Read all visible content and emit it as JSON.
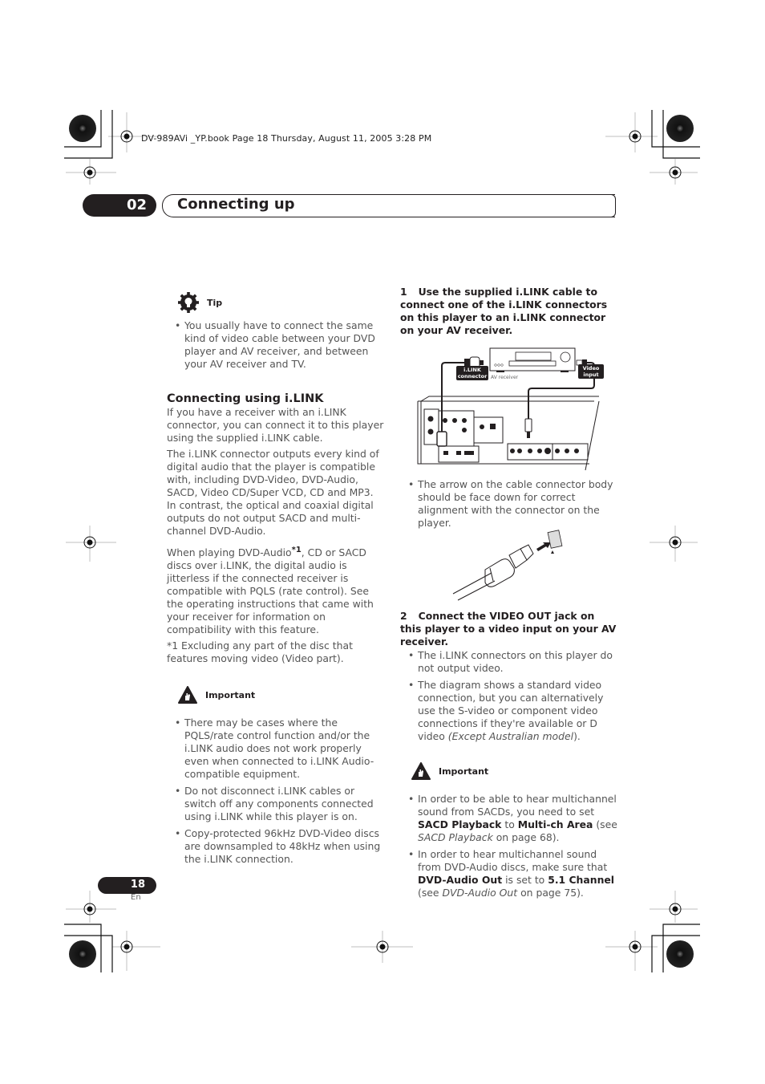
{
  "print_header": "DV-989AVi _YP.book  Page 18  Thursday, August 11, 2005  3:28 PM",
  "chapter": {
    "number": "02",
    "title": "Connecting up"
  },
  "left_column": {
    "tip": {
      "icon": "lightbulb-gear-icon",
      "label": "Tip",
      "bullets": [
        "You usually have to connect the same kind of video cable between your DVD player and AV receiver, and between your AV receiver and TV."
      ]
    },
    "section_heading": "Connecting using i.LINK",
    "paragraphs": [
      "If you have a receiver with an i.LINK connector, you can connect it to this player using the supplied i.LINK cable.",
      "The i.LINK connector outputs every kind of digital audio that the player is compatible with, including DVD-Video, DVD-Audio, SACD, Video CD/Super VCD, CD and MP3. In contrast, the optical and coaxial digital outputs do not output SACD and multi-channel DVD-Audio."
    ],
    "para3_before": "When playing DVD-Audio",
    "para3_footnote_ref": "*1",
    "para3_after": ", CD or SACD discs over i.LINK, the digital audio is jitterless if the connected receiver is compatible with PQLS (rate control). See the operating instructions that came with your receiver for information on compatibility with this feature.",
    "footnote": "*1 Excluding any part of the disc that features moving video (Video part).",
    "important": {
      "icon": "warning-hand-icon",
      "label": "Important",
      "bullets": [
        "There may be cases where the PQLS/rate control function and/or the i.LINK audio does not work properly even when connected to i.LINK Audio-compatible equipment.",
        "Do not disconnect i.LINK cables or switch off any components connected using i.LINK while this player is on.",
        "Copy-protected 96kHz DVD-Video discs are downsampled to 48kHz when using the i.LINK connection."
      ]
    }
  },
  "right_column": {
    "step1": {
      "number": "1",
      "text": "Use the supplied i.LINK cable to connect one of the i.LINK connectors on this player to an i.LINK connector on your AV receiver."
    },
    "diagram": {
      "label_ilink_line1": "i.LINK",
      "label_ilink_line2": "connector",
      "label_receiver": "AV receiver",
      "label_video_line1": "Video",
      "label_video_line2": "input"
    },
    "step1_bullet": "The arrow on the cable connector body should be face down for correct alignment with the connector on the player.",
    "step2": {
      "number": "2",
      "text": "Connect the VIDEO OUT jack on this player to a video input on your AV receiver."
    },
    "step2_bullets": {
      "b1": "The i.LINK connectors on this player do not output video.",
      "b2_text": "The diagram shows a standard video connection, but you can alternatively use the S-video or component video connections if they're available or D video ",
      "b2_italic": "(Except Australian model",
      "b2_end": ")."
    },
    "important": {
      "label": "Important",
      "b1": {
        "t1": "In order to be able to hear multichannel sound from SACDs, you need to set ",
        "k1": "SACD Playback",
        "t2": " to ",
        "k2": "Multi-ch Area",
        "t3": " (see ",
        "i1": "SACD Playback",
        "t4": " on page 68)."
      },
      "b2": {
        "t1": "In order to hear multichannel sound from DVD-Audio discs, make sure that ",
        "k1": "DVD-Audio Out",
        "t2": " is set to ",
        "k2": "5.1 Channel",
        "t3": " (see ",
        "i1": "DVD-Audio Out",
        "t4": " on page 75)."
      }
    }
  },
  "footer": {
    "page_number": "18",
    "language": "En"
  }
}
